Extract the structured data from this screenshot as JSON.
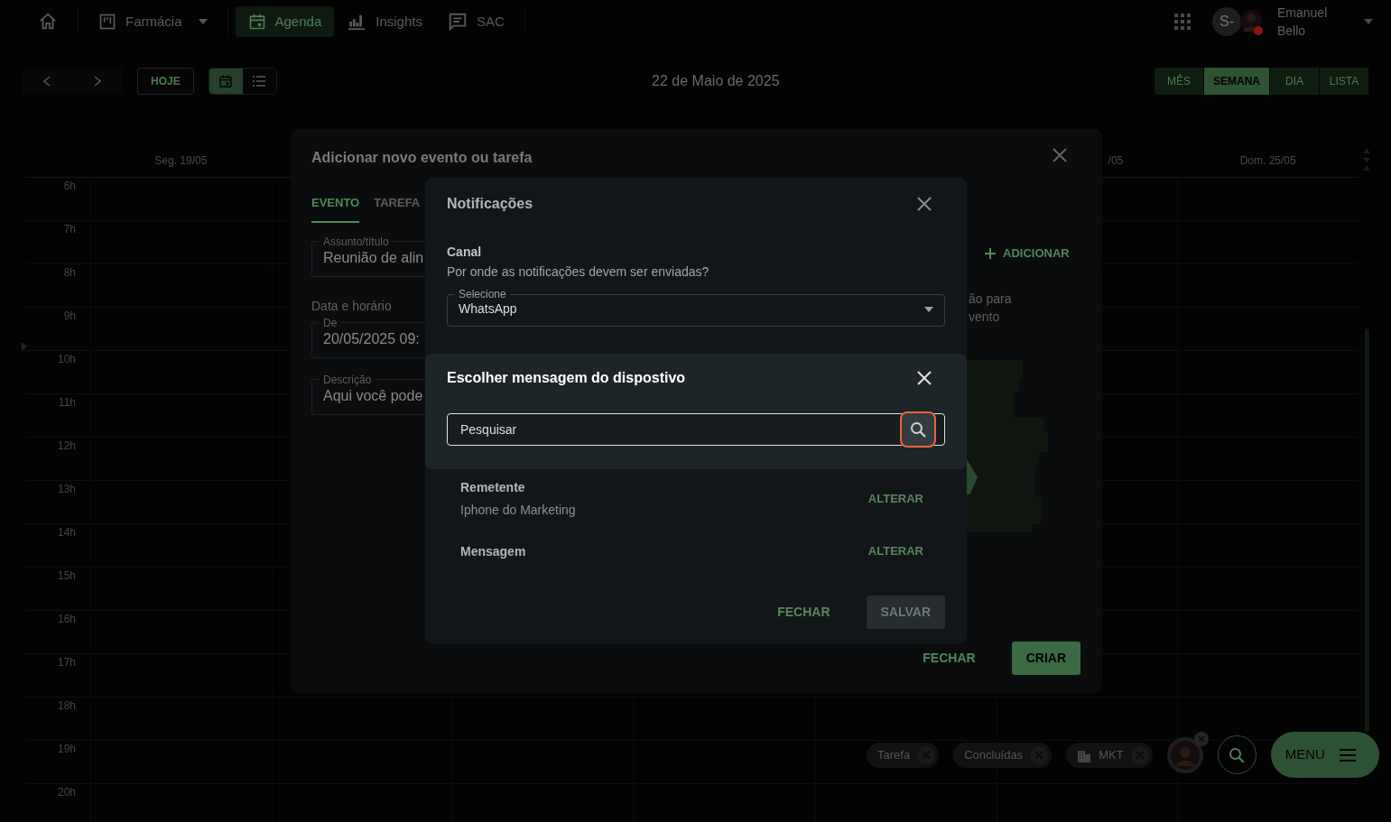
{
  "nav": {
    "items": [
      {
        "kind": "home",
        "selected": false
      },
      {
        "kind": "board",
        "label": "Farmácia",
        "dropdown": true,
        "selected": false
      },
      {
        "kind": "calendar",
        "label": "Agenda",
        "dropdown": false,
        "selected": true
      },
      {
        "kind": "chart",
        "label": "Insights",
        "dropdown": false,
        "selected": false
      },
      {
        "kind": "chat",
        "label": "SAC",
        "dropdown": false,
        "selected": false
      }
    ],
    "user": {
      "initials": "S-",
      "first_name": "Emanuel",
      "last_name": "Bello"
    }
  },
  "toolbar": {
    "today": "HOJE",
    "view_toggle": [
      {
        "kind": "calendar",
        "selected": true
      },
      {
        "kind": "list",
        "selected": false
      }
    ],
    "title": "22 de Maio de 2025",
    "views": [
      {
        "label": "MÊS",
        "selected": false
      },
      {
        "label": "SEMANA",
        "selected": true
      },
      {
        "label": "DIA",
        "selected": false
      },
      {
        "label": "LISTA",
        "selected": false
      }
    ]
  },
  "calendar": {
    "day_headers": [
      "Seg. 19/05",
      "/05",
      "Dom. 25/05"
    ],
    "hours": [
      "6h",
      "7h",
      "8h",
      "9h",
      "10h",
      "11h",
      "12h",
      "13h",
      "14h",
      "15h",
      "16h",
      "17h",
      "18h",
      "19h",
      "20h"
    ]
  },
  "event_modal": {
    "title": "Adicionar novo evento ou tarefa",
    "tabs": [
      {
        "label": "EVENTO",
        "selected": true
      },
      {
        "label": "TAREFA",
        "selected": false
      }
    ],
    "form_items": [
      {
        "kind": "field",
        "label": "Assunto/título",
        "value": "Reunião de alin"
      },
      {
        "kind": "heading",
        "text": "Data e horário"
      },
      {
        "kind": "field",
        "label": "De",
        "value": "20/05/2025 09:"
      },
      {
        "kind": "field",
        "label": "Descrição",
        "value": "Aqui você pode"
      }
    ],
    "add_button": "ADICIONAR",
    "hint_lines": [
      "ão para",
      "vento"
    ],
    "buttons": [
      {
        "label": "FECHAR",
        "kind": "text"
      },
      {
        "label": "CRIAR",
        "kind": "filled"
      }
    ]
  },
  "notifications_modal": {
    "title": "Notificações",
    "channel": {
      "label": "Canal",
      "help": "Por onde as notificações devem ser enviadas?",
      "select": {
        "label": "Selecione",
        "value": "WhatsApp"
      }
    },
    "rows": [
      {
        "label": "Remetente",
        "value": "Iphone do Marketing",
        "action": "ALTERAR"
      },
      {
        "label": "Mensagem",
        "action": "ALTERAR"
      }
    ],
    "buttons": [
      {
        "label": "FECHAR",
        "kind": "text",
        "disabled": false
      },
      {
        "label": "SALVAR",
        "kind": "filled",
        "disabled": true
      }
    ]
  },
  "message_modal": {
    "title": "Escolher mensagem do dispostivo",
    "search": {
      "placeholder": "Pesquisar",
      "focused": true
    }
  },
  "filters": [
    {
      "label": "Tarefa",
      "kind": "text"
    },
    {
      "label": "Concluídas",
      "kind": "text"
    },
    {
      "label": "MKT",
      "kind": "team"
    }
  ],
  "menu_button": "MENU"
}
